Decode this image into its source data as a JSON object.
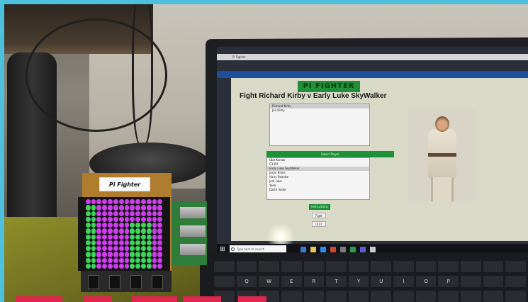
{
  "pi_label": "Pi Fighter",
  "app": {
    "window_title": "Pi Fighter",
    "logo_text": "PI FIGHTER",
    "fight_title": "Fight  Richard Kirby v Early Luke SkyWalker",
    "top_list": {
      "items": [
        "Richard Kirby",
        "Jon Kirby"
      ],
      "selected": 0
    },
    "opponents_header": "Select Player",
    "bottom_list": {
      "items": [
        "Obe Kanob",
        "C3-PO",
        "Early Luke SkyWalker",
        "Jarjar Binks",
        "Hairy Beanbe",
        "Jedi Luke",
        "Yoda",
        "Darth Vader"
      ],
      "selected": 2
    },
    "buttons": {
      "green": "Instructions",
      "fight": "Fight",
      "quit": "QUIT"
    },
    "search_placeholder": "Type here to search"
  },
  "keyboard_row": [
    "Q",
    "W",
    "E",
    "R",
    "T",
    "Y",
    "U",
    "I",
    "O",
    "P"
  ],
  "colors": {
    "frame": "#4cc0dc",
    "app_green": "#1f8f3a",
    "led_green": "#3ed65a",
    "led_pink": "#d03df0",
    "accent_red": "#e1264f"
  }
}
